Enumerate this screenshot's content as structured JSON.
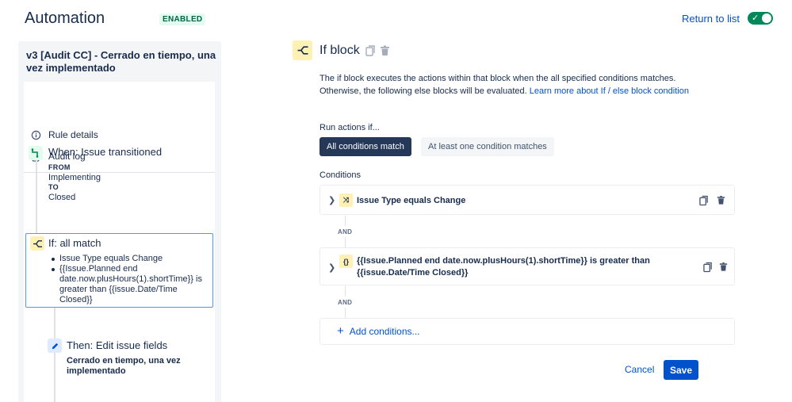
{
  "header": {
    "title": "Automation",
    "status_badge": "ENABLED",
    "return_link": "Return to list",
    "toggle_check": "✓"
  },
  "sidebar": {
    "rule_name": "v3 [Audit CC] - Cerrado en tiempo, una vez implementado",
    "nav": [
      {
        "label": "Rule details",
        "icon": "info-icon"
      },
      {
        "label": "Audit log",
        "icon": "document-icon"
      }
    ],
    "trigger": {
      "title": "When: Issue transitioned",
      "from_label": "FROM",
      "from_value": "Implementing",
      "to_label": "TO",
      "to_value": "Closed"
    },
    "if_block": {
      "title": "If: all match",
      "conditions": [
        "Issue Type equals Change",
        "{{Issue.Planned end date.now.plusHours(1).shortTime}} is greater than {{issue.Date/Time Closed}}"
      ]
    },
    "then": {
      "title": "Then: Edit issue fields",
      "detail": "Cerrado en tiempo, una vez implementado"
    }
  },
  "main": {
    "title": "If block",
    "description": "The if block executes the actions within that block when the all specified conditions matches. Otherwise, the following else blocks will be evaluated.",
    "learn_more": "Learn more about If / else block condition",
    "run_actions_label": "Run actions if...",
    "options": {
      "all": "All conditions match",
      "any": "At least one condition matches",
      "selected": "all"
    },
    "conditions_label": "Conditions",
    "conditions": [
      {
        "icon_glyph": "⤨",
        "text": "Issue Type equals Change"
      },
      {
        "icon_glyph": "{}",
        "text": "{{Issue.Planned end date.now.plusHours(1).shortTime}} is greater than {{issue.Date/Time Closed}}"
      }
    ],
    "and_label": "AND",
    "add_conditions": "Add conditions...",
    "cancel": "Cancel",
    "save": "Save"
  },
  "colors": {
    "primary": "#0052cc",
    "enabled_green": "#00875a",
    "condition_yellow": "#fff0b3",
    "selection_blue": "#4c9aff",
    "dark_button": "#253858"
  }
}
